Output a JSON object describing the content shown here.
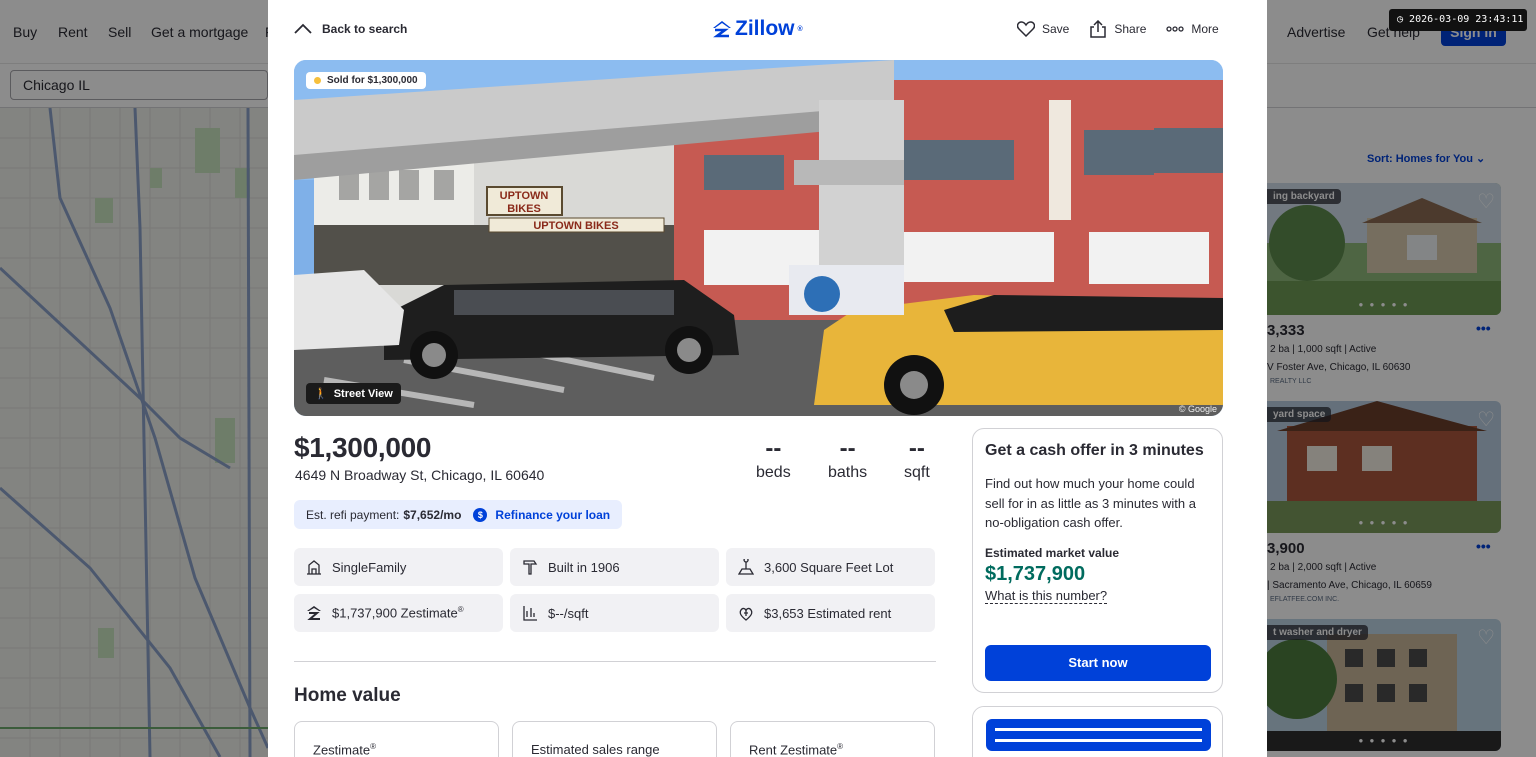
{
  "background": {
    "nav_items": [
      "Buy",
      "Rent",
      "Sell",
      "Get a mortgage",
      "F"
    ],
    "nav_right": [
      "Advertise",
      "Get help"
    ],
    "sign_in": "Sign in",
    "search_value": "Chicago IL",
    "sort_label": "Sort: Homes for You",
    "listings": [
      {
        "tag": "ing backyard",
        "price": "3,333",
        "meta": "2 ba | 1,000 sqft | Active",
        "address": "V Foster Ave, Chicago, IL 60630",
        "broker": "REALTY LLC"
      },
      {
        "tag": "yard space",
        "price": "3,900",
        "meta": "2 ba | 2,000 sqft | Active",
        "address": "| Sacramento Ave, Chicago, IL 60659",
        "broker": "EFLATFEE.COM INC."
      },
      {
        "tag": "t washer and dryer"
      }
    ]
  },
  "timestamp": "2026-03-09 23:43:11",
  "header": {
    "back_label": "Back to search",
    "logo_text": "Zillow",
    "save_label": "Save",
    "share_label": "Share",
    "more_label": "More"
  },
  "photo": {
    "sold_badge": "Sold for $1,300,000",
    "street_view_label": "Street View",
    "credit": "© Google",
    "signs": [
      "UPTOWN",
      "BIKES",
      "UPTOWN BIKES"
    ]
  },
  "listing": {
    "price": "$1,300,000",
    "address": "4649 N Broadway St, Chicago, IL 60640",
    "beds_value": "--",
    "beds_label": "beds",
    "baths_value": "--",
    "baths_label": "baths",
    "sqft_value": "--",
    "sqft_label": "sqft"
  },
  "refi": {
    "label": "Est. refi payment:",
    "amount": "$7,652/mo",
    "link": "Refinance your loan",
    "dollar_symbol": "$"
  },
  "facts": [
    {
      "icon": "home-type-icon",
      "text": "SingleFamily"
    },
    {
      "icon": "hammer-icon",
      "text": "Built in 1906"
    },
    {
      "icon": "lot-icon",
      "text": "3,600 Square Feet Lot"
    },
    {
      "icon": "zestimate-icon",
      "text": "$1,737,900 Zestimate",
      "sup": "®"
    },
    {
      "icon": "price-per-sqft-icon",
      "text": "$--/sqft"
    },
    {
      "icon": "rent-icon",
      "text": "$3,653 Estimated rent"
    }
  ],
  "home_value": {
    "title": "Home value",
    "cards": [
      {
        "label": "Zestimate",
        "sup": "®"
      },
      {
        "label": "Estimated sales range",
        "sup": ""
      },
      {
        "label": "Rent Zestimate",
        "sup": "®"
      }
    ]
  },
  "cash_offer": {
    "title": "Get a cash offer in 3 minutes",
    "description": "Find out how much your home could sell for in as little as 3 minutes with a no-obligation cash offer.",
    "market_label": "Estimated market value",
    "market_value": "$1,737,900",
    "info_link": "What is this number?",
    "button": "Start now"
  },
  "colors": {
    "brand_blue": "#0041d9",
    "value_green": "#006b5e",
    "sold_dot": "#f7c03c"
  }
}
